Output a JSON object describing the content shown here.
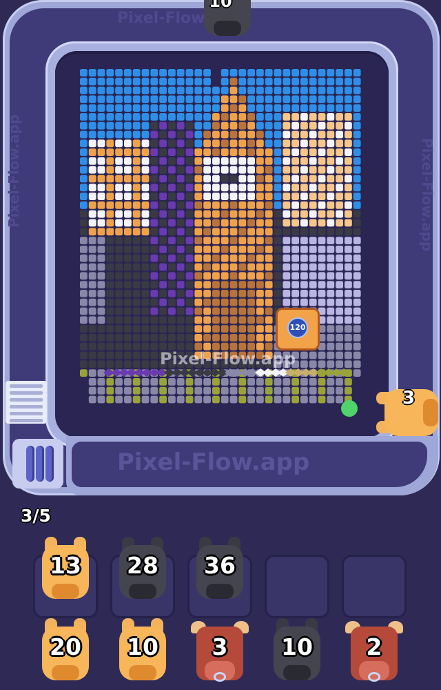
{
  "game": {
    "watermark": "Pixel-Flow.app",
    "belt_text": "Pixel-Flow.app",
    "progress_counter": "3/5",
    "board_target_value": "120"
  },
  "belt_pigs": [
    {
      "value": "10",
      "color": "black",
      "position": "top"
    },
    {
      "value": "3",
      "color": "orange",
      "position": "right"
    }
  ],
  "queue_row1": [
    {
      "value": "13",
      "type": "piggy",
      "color": "orange"
    },
    {
      "value": "28",
      "type": "piggy",
      "color": "black"
    },
    {
      "value": "36",
      "type": "piggy",
      "color": "black"
    },
    {
      "value": "",
      "type": "empty"
    },
    {
      "value": "",
      "type": "empty"
    }
  ],
  "queue_row2": [
    {
      "value": "20",
      "type": "piggy",
      "color": "orange"
    },
    {
      "value": "10",
      "type": "piggy",
      "color": "orange"
    },
    {
      "value": "3",
      "type": "bull",
      "color": "red"
    },
    {
      "value": "10",
      "type": "piggy",
      "color": "black"
    },
    {
      "value": "2",
      "type": "bull",
      "color": "red"
    }
  ],
  "colors": {
    "sky_blue": "#2f8fe8",
    "cloud_white": "#f4f4f8",
    "lavender": "#b9b6e4",
    "orange": "#f0a24a",
    "light_orange": "#f6c68a",
    "dark": "#3a3a44",
    "purple": "#6a3ab0",
    "brown": "#b8743a",
    "olive": "#9aa33a",
    "grey": "#8a88a8"
  }
}
